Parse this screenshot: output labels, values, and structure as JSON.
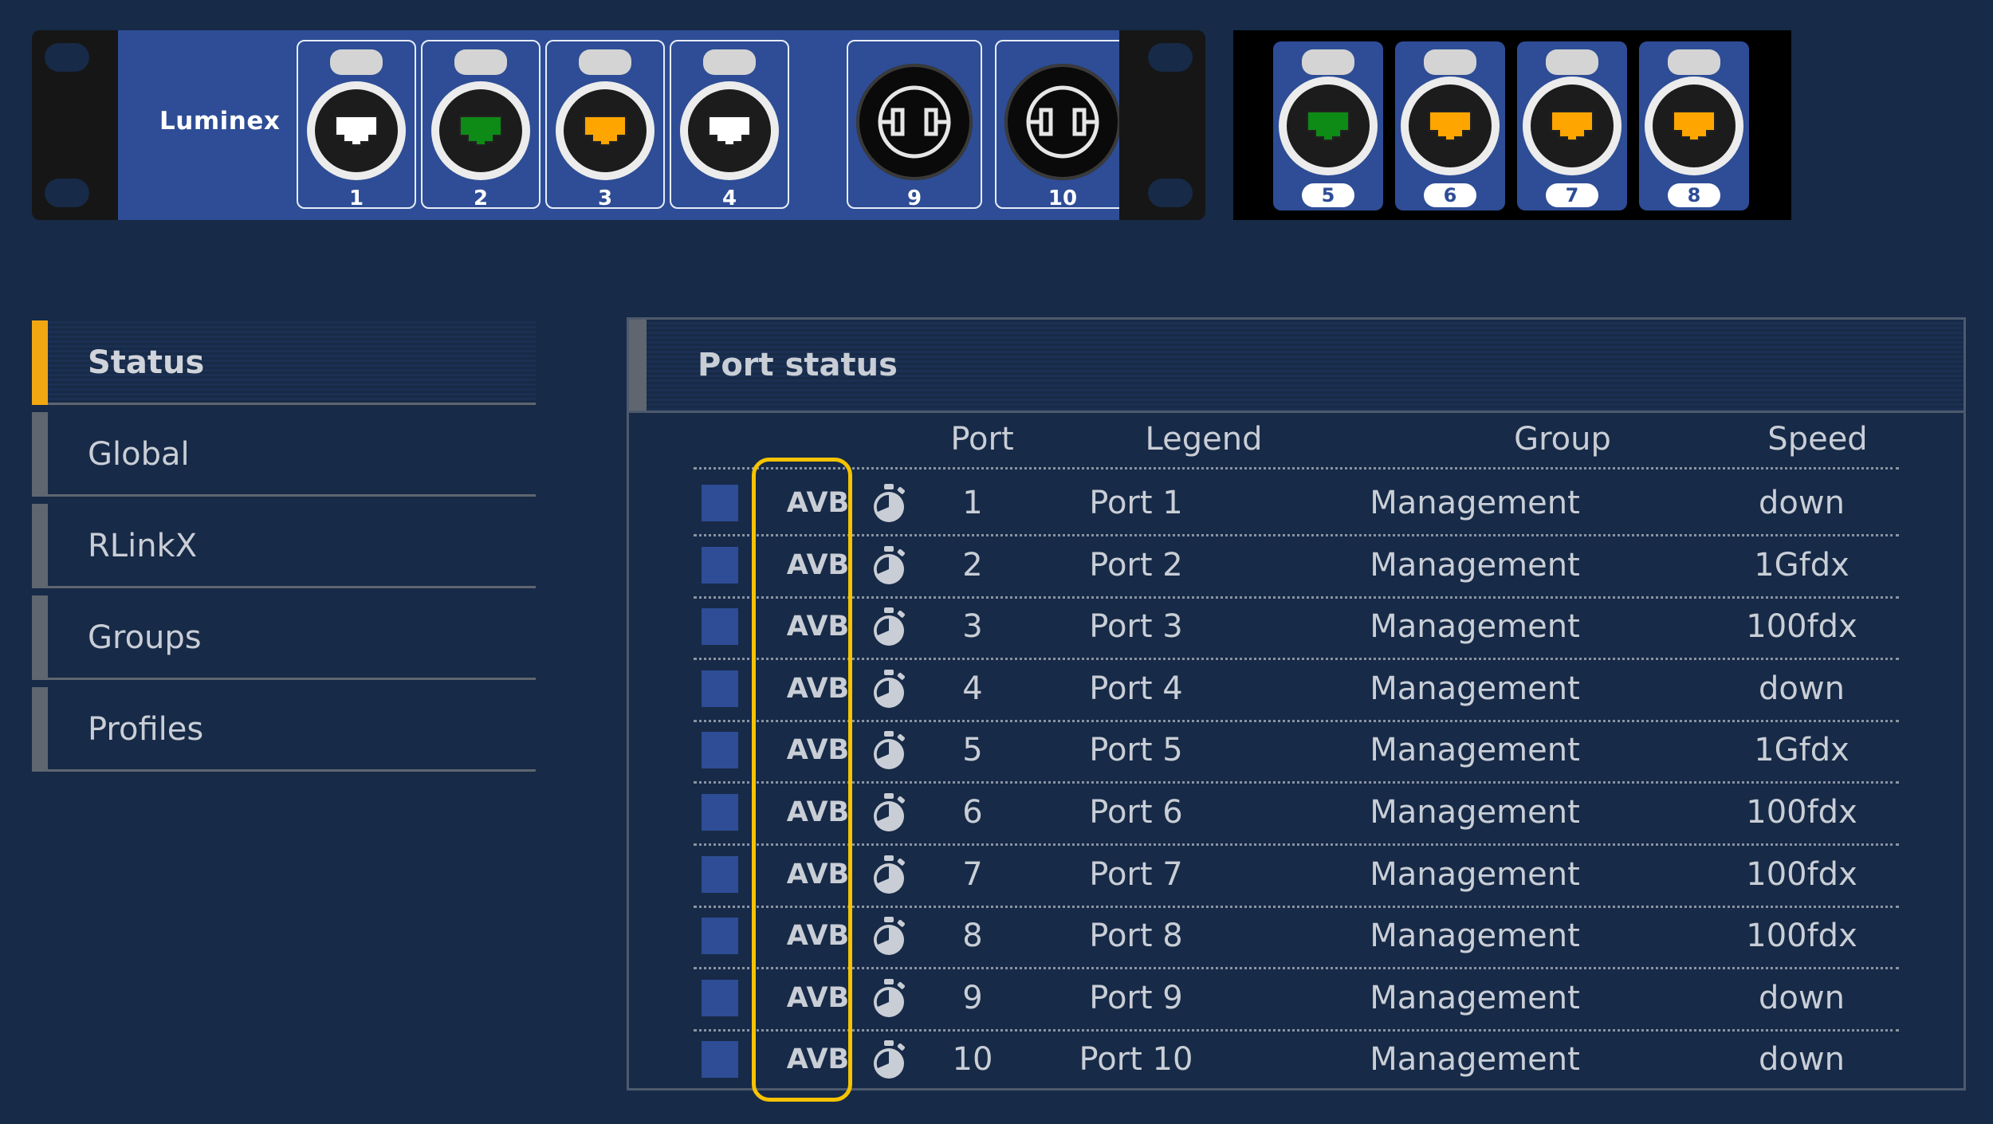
{
  "device": {
    "brand": "Luminex",
    "main_ports": [
      {
        "label": "1",
        "color": "#ffffff"
      },
      {
        "label": "2",
        "color": "#0e8a16"
      },
      {
        "label": "3",
        "color": "#ffa500"
      },
      {
        "label": "4",
        "color": "#ffffff"
      }
    ],
    "xlr_ports": [
      {
        "label": "9"
      },
      {
        "label": "10"
      }
    ],
    "expansion_ports": [
      {
        "label": "5",
        "color": "#0e8a16"
      },
      {
        "label": "6",
        "color": "#ffa500"
      },
      {
        "label": "7",
        "color": "#ffa500"
      },
      {
        "label": "8",
        "color": "#ffa500"
      }
    ]
  },
  "sidebar": {
    "items": [
      {
        "label": "Status",
        "active": true
      },
      {
        "label": "Global",
        "active": false
      },
      {
        "label": "RLinkX",
        "active": false
      },
      {
        "label": "Groups",
        "active": false
      },
      {
        "label": "Profiles",
        "active": false
      }
    ]
  },
  "panel": {
    "title": "Port status",
    "headers": {
      "port": "Port",
      "legend": "Legend",
      "group": "Group",
      "speed": "Speed"
    },
    "rows": [
      {
        "avb": "AVB",
        "port": "1",
        "legend": "Port 1",
        "group": "Management",
        "speed": "down"
      },
      {
        "avb": "AVB",
        "port": "2",
        "legend": "Port 2",
        "group": "Management",
        "speed": "1Gfdx"
      },
      {
        "avb": "AVB",
        "port": "3",
        "legend": "Port 3",
        "group": "Management",
        "speed": "100fdx"
      },
      {
        "avb": "AVB",
        "port": "4",
        "legend": "Port 4",
        "group": "Management",
        "speed": "down"
      },
      {
        "avb": "AVB",
        "port": "5",
        "legend": "Port 5",
        "group": "Management",
        "speed": "1Gfdx"
      },
      {
        "avb": "AVB",
        "port": "6",
        "legend": "Port 6",
        "group": "Management",
        "speed": "100fdx"
      },
      {
        "avb": "AVB",
        "port": "7",
        "legend": "Port 7",
        "group": "Management",
        "speed": "100fdx"
      },
      {
        "avb": "AVB",
        "port": "8",
        "legend": "Port 8",
        "group": "Management",
        "speed": "100fdx"
      },
      {
        "avb": "AVB",
        "port": "9",
        "legend": "Port 9",
        "group": "Management",
        "speed": "down"
      },
      {
        "avb": "AVB",
        "port": "10",
        "legend": "Port 10",
        "group": "Management",
        "speed": "down"
      }
    ]
  },
  "colors": {
    "background": "#172a47",
    "device_blue": "#2e4d96",
    "active_accent": "#f0a712",
    "highlight": "#f5c300"
  }
}
